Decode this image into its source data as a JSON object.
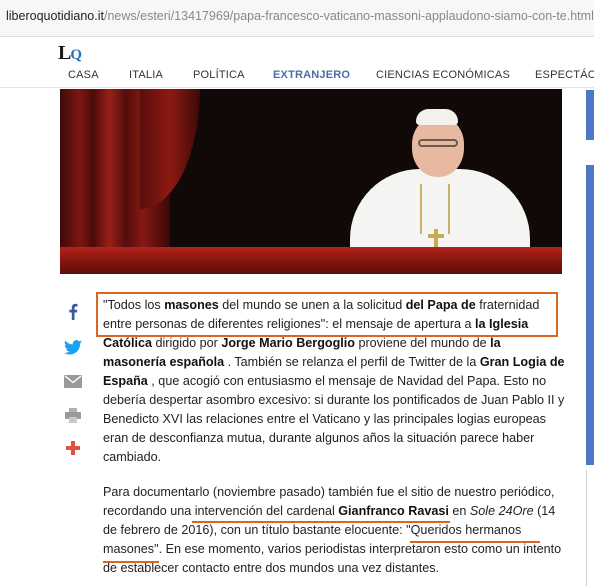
{
  "address_bar": {
    "domain": "liberoquotidiano.it",
    "path": "/news/esteri/13417969/papa-francesco-vaticano-massoni-applaudono-siamo-con-te.html"
  },
  "site": {
    "logo_l": "L",
    "logo_q": "Q",
    "nav": [
      "CASA",
      "ITALIA",
      "POLÍTICA",
      "EXTRANJERO",
      "CIENCIAS ECONÓMICAS",
      "ESPECTÁCU"
    ],
    "active_nav": "EXTRANJERO"
  },
  "share_icons": [
    "facebook-icon",
    "twitter-icon",
    "email-icon",
    "print-icon",
    "plus-icon"
  ],
  "colors": {
    "highlight": "#d9681f",
    "nav_active": "#4a6fa5",
    "sidebar_accent": "#4e78c7"
  },
  "article": {
    "p1": {
      "s1": "\"Todos los ",
      "b1": "masones",
      "s2": " del mundo se unen a la solicitud ",
      "b2": "del Papa de",
      "s3": " fraternidad entre personas de diferentes religiones\": el mensaje de apertura a ",
      "b3": "la Iglesia Católica",
      "s4": " dirigido por ",
      "b4": "Jorge Mario Bergoglio",
      "s5": " proviene del mundo de ",
      "b5": "la masonería española",
      "s6": " . También se relanza el perfil de Twitter de la ",
      "b6": "Gran Logia de España",
      "s7": " , que acogió con entusiasmo el mensaje de Navidad del Papa. Esto no debería despertar asombro excesivo: si durante los pontificados de Juan Pablo II y Benedicto XVI las relaciones entre el Vaticano y las principales logias europeas eran de desconfianza mutua, durante algunos años la situación parece haber cambiado."
    },
    "p2": {
      "s1": "Para documentarlo (noviembre pasado) también fue el sitio de nuestro periódico, recordando una ",
      "s2": "intervención del cardenal ",
      "b1": "Gianfranco Ravasi",
      "s3": " en ",
      "i1": "Sole 24Ore",
      "s4": " (14 de febrero de 2016), con un título bastante elocuente: \"",
      "s5": "Queridos hermanos masones",
      "s6": "\". En ese momento, varios periodistas interpretaron esto como un intento de establecer contacto entre dos mundos una vez distantes."
    }
  }
}
